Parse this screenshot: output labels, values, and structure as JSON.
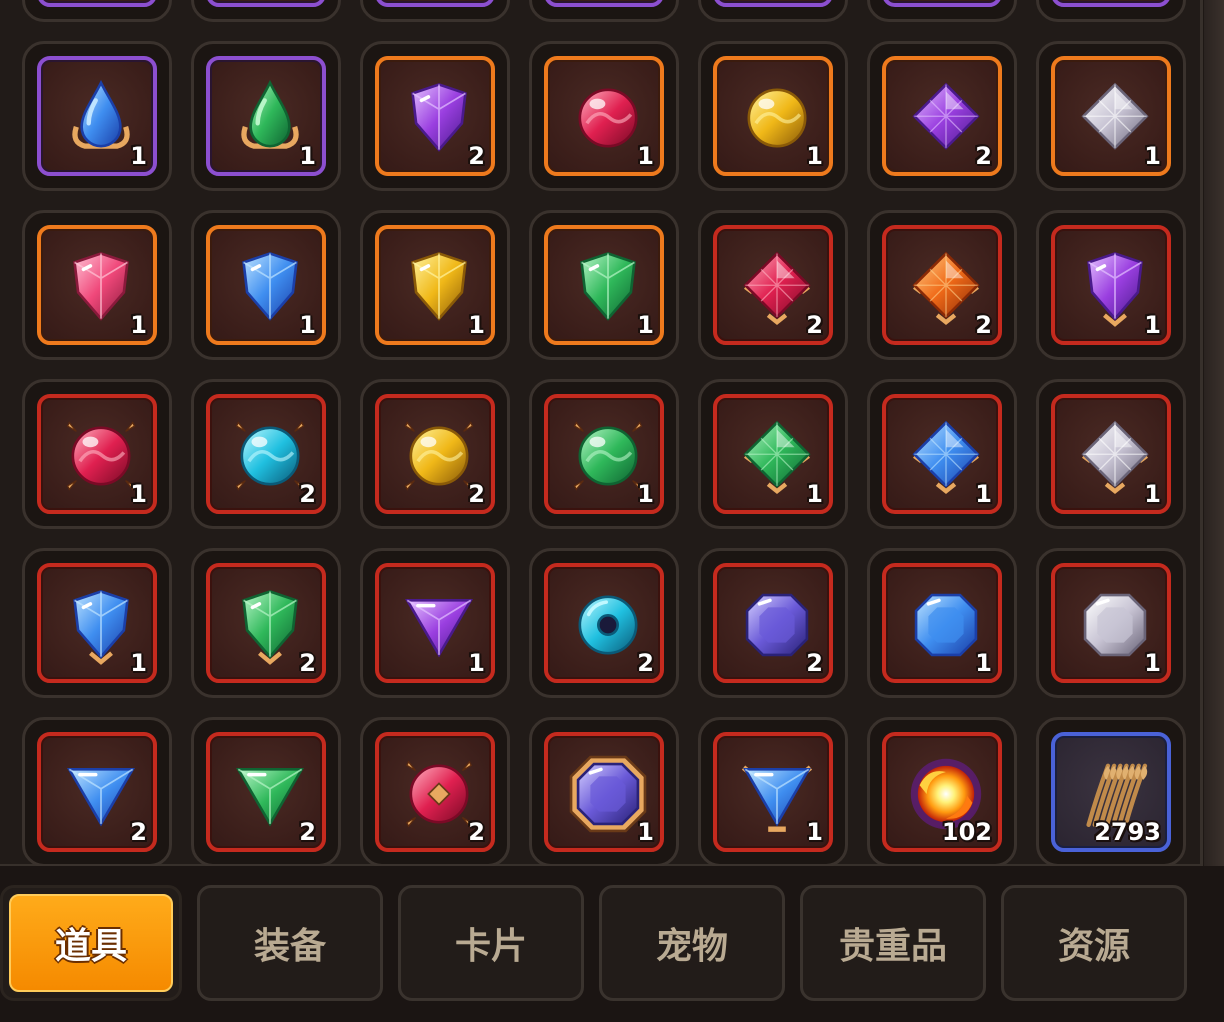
{
  "inventory": {
    "rows": [
      [
        {
          "item": "blue-teardrop-gem-icon",
          "frame": "purple",
          "count": "1"
        },
        {
          "item": "green-teardrop-gem-icon",
          "frame": "purple",
          "count": "1"
        },
        {
          "item": "purple-shield-gem-icon",
          "frame": "orange",
          "count": "2"
        },
        {
          "item": "red-orb-gem-icon",
          "frame": "orange",
          "count": "1"
        },
        {
          "item": "yellow-orb-gem-icon",
          "frame": "orange",
          "count": "1"
        },
        {
          "item": "purple-diamond-gem-icon",
          "frame": "orange",
          "count": "2"
        },
        {
          "item": "white-diamond-gem-icon",
          "frame": "orange",
          "count": "1"
        }
      ],
      [
        {
          "item": "pink-shield-gem-icon",
          "frame": "orange",
          "count": "1"
        },
        {
          "item": "blue-shield-gem-icon",
          "frame": "orange",
          "count": "1"
        },
        {
          "item": "yellow-shield-gem-icon",
          "frame": "orange",
          "count": "1"
        },
        {
          "item": "green-shield-gem-icon",
          "frame": "orange",
          "count": "1"
        },
        {
          "item": "red-diamond-gem-icon",
          "frame": "red",
          "count": "2"
        },
        {
          "item": "orange-diamond-gem-icon",
          "frame": "red",
          "count": "2"
        },
        {
          "item": "purple-pendant-gem-icon",
          "frame": "red",
          "count": "1"
        }
      ],
      [
        {
          "item": "red-set-orb-icon",
          "frame": "red",
          "count": "1"
        },
        {
          "item": "cyan-set-orb-icon",
          "frame": "red",
          "count": "2"
        },
        {
          "item": "yellow-set-orb-icon",
          "frame": "red",
          "count": "2"
        },
        {
          "item": "green-set-orb-icon",
          "frame": "red",
          "count": "1"
        },
        {
          "item": "green-set-diamond-icon",
          "frame": "red",
          "count": "1"
        },
        {
          "item": "blue-set-diamond-icon",
          "frame": "red",
          "count": "1"
        },
        {
          "item": "white-set-diamond-icon",
          "frame": "red",
          "count": "1"
        }
      ],
      [
        {
          "item": "blue-pendant-gem-icon",
          "frame": "red",
          "count": "1"
        },
        {
          "item": "green-pendant-gem-icon",
          "frame": "red",
          "count": "2"
        },
        {
          "item": "purple-triangle-gem-icon",
          "frame": "red",
          "count": "1"
        },
        {
          "item": "cyan-ring-icon",
          "frame": "red",
          "count": "2"
        },
        {
          "item": "purple-octagon-gem-icon",
          "frame": "red",
          "count": "2"
        },
        {
          "item": "blue-octagon-gem-icon",
          "frame": "red",
          "count": "1"
        },
        {
          "item": "white-octagon-gem-icon",
          "frame": "red",
          "count": "1"
        }
      ],
      [
        {
          "item": "blue-triangle-gem-icon",
          "frame": "red",
          "count": "2"
        },
        {
          "item": "green-triangle-gem-icon",
          "frame": "red",
          "count": "2"
        },
        {
          "item": "red-rune-orb-icon",
          "frame": "red",
          "count": "2"
        },
        {
          "item": "purple-framed-octagon-icon",
          "frame": "red",
          "count": "1"
        },
        {
          "item": "blue-set-triangle-icon",
          "frame": "red",
          "count": "1"
        },
        {
          "item": "fire-orb-icon",
          "frame": "red",
          "count": "102"
        },
        {
          "item": "wheat-bundle-icon",
          "frame": "blue",
          "count": "2793"
        }
      ]
    ]
  },
  "tabs": [
    {
      "label": "道具",
      "active": true
    },
    {
      "label": "装备",
      "active": false
    },
    {
      "label": "卡片",
      "active": false
    },
    {
      "label": "宠物",
      "active": false
    },
    {
      "label": "贵重品",
      "active": false
    },
    {
      "label": "资源",
      "active": false
    }
  ],
  "colors": {
    "frame_purple": "#8c4fd0",
    "frame_orange": "#ee7a1d",
    "frame_red": "#c52a1e",
    "frame_blue": "#4a62d8",
    "tab_active": "#f5a000"
  }
}
